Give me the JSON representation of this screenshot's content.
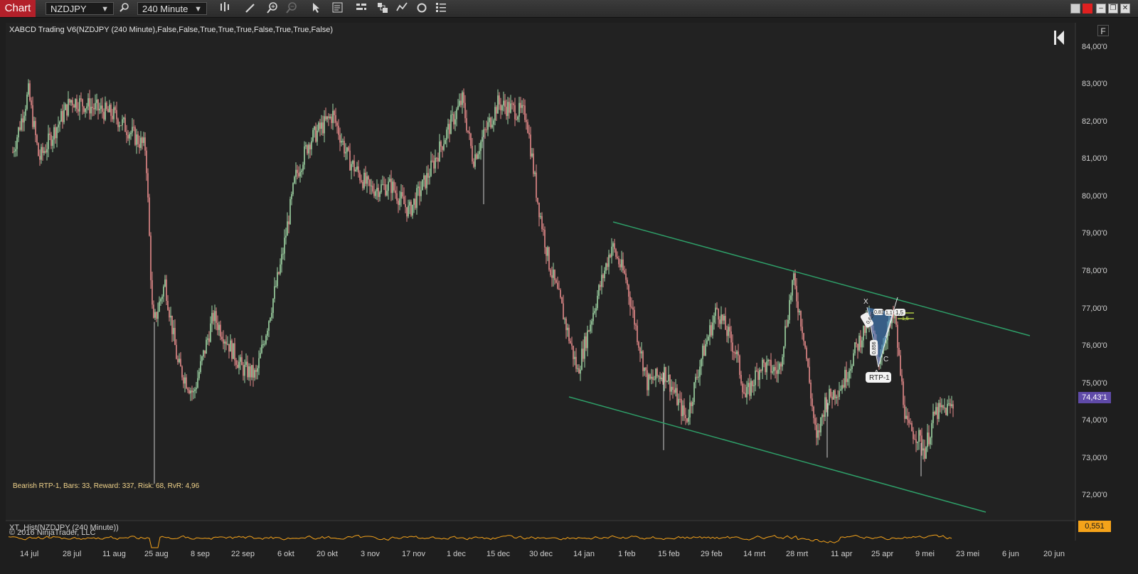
{
  "toolbar": {
    "chart_tab": "Chart",
    "instrument": "NZDJPY",
    "interval": "240 Minute"
  },
  "chart": {
    "indicator_title": "XABCD Trading V6(NZDJPY (240 Minute),False,False,True,True,True,False,True,True,False)",
    "status": "Bearish RTP-1, Bars: 33, Reward: 337, Risk: 68, RvR: 4,96",
    "f_button": "F",
    "last_price": "74,43'1",
    "price_axis": [
      "84,00'0",
      "83,00'0",
      "82,00'0",
      "81,00'0",
      "80,00'0",
      "79,00'0",
      "78,00'0",
      "77,00'0",
      "76,00'0",
      "75,00'0",
      "74,00'0",
      "73,00'0",
      "72,00'0"
    ],
    "date_axis": [
      "14 jul",
      "28 jul",
      "11 aug",
      "25 aug",
      "8 sep",
      "22 sep",
      "6 okt",
      "20 okt",
      "3 nov",
      "17 nov",
      "1 dec",
      "15 dec",
      "30 dec",
      "14 jan",
      "1 feb",
      "15 feb",
      "29 feb",
      "14 mrt",
      "28 mrt",
      "11 apr",
      "25 apr",
      "9 mei",
      "23 mei",
      "6 jun",
      "20 jun"
    ],
    "pattern_labels": {
      "x": "X",
      "a": "A",
      "c": "C",
      "name": "RTP-1",
      "ratio_1": "0,620",
      "ratio_2": "0,856",
      "ratio_3": "0,81",
      "ratio_4": "1,1",
      "target_1": "1,5",
      "target_2": "1,5"
    },
    "colors": {
      "up_candle": "#9fd6a5",
      "down_candle": "#e58a8a",
      "channel": "#2e9e68",
      "indicator_line": "#f5a31a",
      "price_badge": "#5f4aa8"
    }
  },
  "indicator_panel": {
    "label": "XT_Hist(NZDJPY (240 Minute))",
    "copyright": "© 2016 NinjaTrader, LLC",
    "value": "0,551"
  }
}
